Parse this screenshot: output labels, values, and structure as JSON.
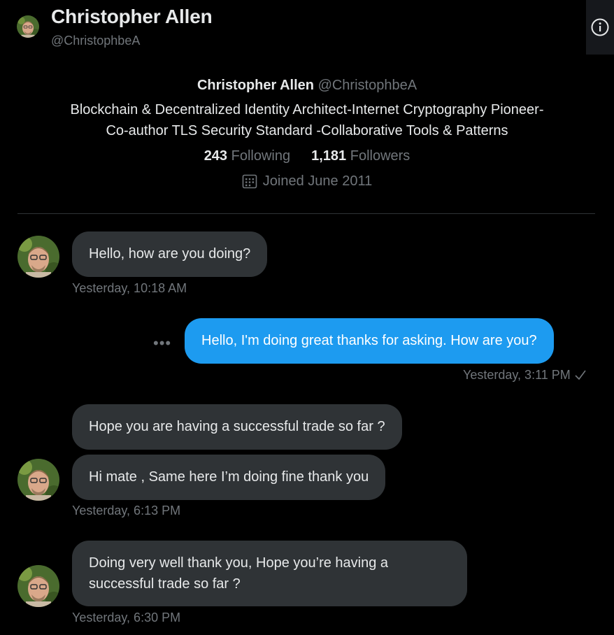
{
  "header": {
    "name": "Christopher Allen",
    "handle": "@ChristophbeA",
    "info_icon": "info-icon"
  },
  "profile": {
    "name": "Christopher Allen",
    "handle": "@ChristophbeA",
    "bio_line1": "Blockchain & Decentralized Identity Architect-Internet Cryptography Pioneer-",
    "bio_line2": "Co-author TLS Security Standard -Collaborative Tools & Patterns",
    "following_count": "243",
    "following_label": "Following",
    "followers_count": "1,181",
    "followers_label": "Followers",
    "joined": "Joined June 2011",
    "joined_icon": "calendar-icon"
  },
  "messages": [
    {
      "direction": "in",
      "text": "Hello, how are you doing?",
      "timestamp": "Yesterday, 10:18 AM"
    },
    {
      "direction": "out",
      "text": "Hello, I'm doing great thanks for asking. How are you?",
      "timestamp": "Yesterday, 3:11 PM",
      "status_icon": "checkmark-icon"
    },
    {
      "direction": "in",
      "text": "Hope you are having a successful trade so far ?"
    },
    {
      "direction": "in",
      "text": "Hi mate , Same here I’m doing fine thank you",
      "timestamp": "Yesterday, 6:13 PM"
    },
    {
      "direction": "in",
      "text_line1": "Doing very well thank you, Hope you’re having a",
      "text_line2": "successful trade so far ?",
      "timestamp": "Yesterday, 6:30 PM"
    }
  ],
  "more_options_icon": "more-horizontal-icon",
  "colors": {
    "background": "#000000",
    "bubble_in": "#2f3336",
    "bubble_out": "#1d9bf0",
    "muted_text": "#71767b"
  }
}
